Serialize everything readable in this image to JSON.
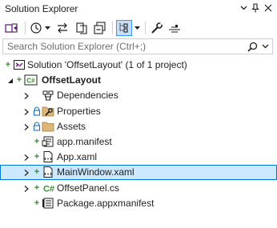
{
  "title": "Solution Explorer",
  "title_buttons": [
    "pin-dropdown",
    "pin",
    "close"
  ],
  "search": {
    "placeholder": "Search Solution Explorer (Ctrl+;)",
    "value": ""
  },
  "tree": [
    {
      "label": "Solution 'OffsetLayout' (1 of 1 project)",
      "icon": "solution-icon",
      "level": 0,
      "expander": "none",
      "status": "plus",
      "bold": false,
      "selected": false
    },
    {
      "label": "OffsetLayout",
      "icon": "csharp-project-icon",
      "level": 1,
      "expander": "expanded",
      "status": "plus",
      "bold": true,
      "selected": false
    },
    {
      "label": "Dependencies",
      "icon": "dependencies-icon",
      "level": 2,
      "expander": "collapsed",
      "status": "none",
      "bold": false,
      "selected": false
    },
    {
      "label": "Properties",
      "icon": "properties-folder-icon",
      "level": 2,
      "expander": "collapsed",
      "status": "lock",
      "bold": false,
      "selected": false
    },
    {
      "label": "Assets",
      "icon": "folder-icon",
      "level": 2,
      "expander": "collapsed",
      "status": "lock",
      "bold": false,
      "selected": false
    },
    {
      "label": "app.manifest",
      "icon": "manifest-icon",
      "level": 2,
      "expander": "none",
      "status": "plus",
      "bold": false,
      "selected": false
    },
    {
      "label": "App.xaml",
      "icon": "xaml-icon",
      "level": 2,
      "expander": "collapsed",
      "status": "plus",
      "bold": false,
      "selected": false
    },
    {
      "label": "MainWindow.xaml",
      "icon": "xaml-icon",
      "level": 2,
      "expander": "collapsed",
      "status": "plus",
      "bold": false,
      "selected": true
    },
    {
      "label": "OffsetPanel.cs",
      "icon": "csharp-file-icon",
      "level": 2,
      "expander": "collapsed",
      "status": "plus",
      "bold": false,
      "selected": false
    },
    {
      "label": "Package.appxmanifest",
      "icon": "appxmanifest-icon",
      "level": 2,
      "expander": "none",
      "status": "plus",
      "bold": false,
      "selected": false
    }
  ],
  "colors": {
    "selection_bg": "#cce8ff",
    "selection_border": "#0078d7",
    "accent_purple": "#68217a",
    "status_green": "#388a34",
    "folder_yellow": "#dcb67a"
  }
}
